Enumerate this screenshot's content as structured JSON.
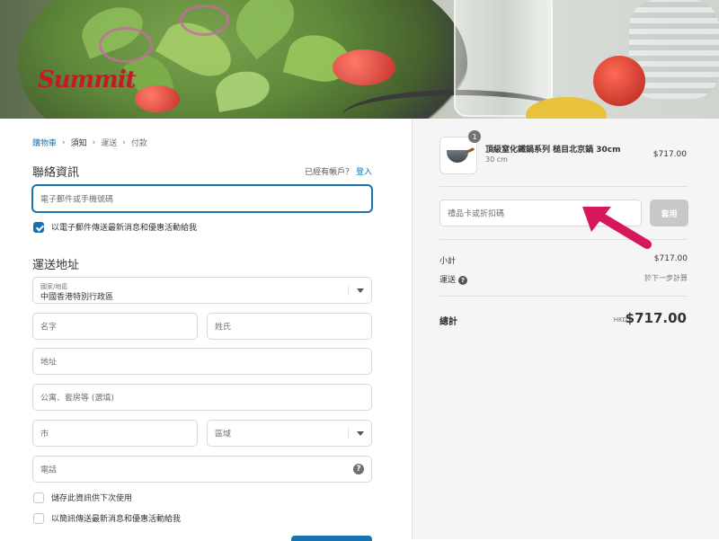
{
  "brand": {
    "logo_text": "Summit"
  },
  "breadcrumb": [
    {
      "label": "購物車",
      "state": "link"
    },
    {
      "label": "須知",
      "state": "current"
    },
    {
      "label": "運送",
      "state": "upcoming"
    },
    {
      "label": "付款",
      "state": "upcoming"
    }
  ],
  "contact": {
    "title": "聯絡資訊",
    "have_account": "已經有帳戶？",
    "login_link": "登入",
    "email_placeholder": "電子郵件或手機號碼",
    "email_opt_in": "以電子郵件傳送最新消息和優惠活動給我",
    "email_opt_in_checked": true
  },
  "shipping": {
    "title": "運送地址",
    "country_label": "國家/地區",
    "country_value": "中國香港特別行政區",
    "first_name": "名字",
    "last_name": "姓氏",
    "address": "地址",
    "apartment": "公寓、套房等 (選填)",
    "city": "市",
    "region": "區域",
    "phone": "電話",
    "save_info": "儲存此資訊供下次使用",
    "sms_opt_in": "以簡訊傳送最新消息和優惠活動給我"
  },
  "summary": {
    "item": {
      "quantity": "1",
      "name": "頂級窒化鐵鍋系列 槌目北京鍋 30cm",
      "variant": "30 cm",
      "price": "$717.00"
    },
    "gift_placeholder": "禮品卡或折扣碼",
    "apply_label": "套用",
    "subtotal_label": "小計",
    "subtotal_value": "$717.00",
    "shipping_label": "運送",
    "shipping_value": "於下一步計算",
    "total_label": "總計",
    "total_currency": "HKD",
    "total_value": "$717.00"
  },
  "colors": {
    "accent": "#1773b0",
    "brand_red": "#c41a28",
    "annotation_arrow": "#d6175b"
  }
}
